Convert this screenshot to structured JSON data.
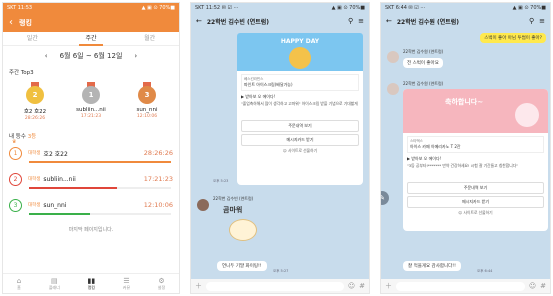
{
  "screen1": {
    "status": {
      "left": "SKT 11:53",
      "right": "▲ ▣ ⊙ 70%■"
    },
    "header": {
      "back_icon": "chevron-left-icon",
      "title": "랭킹"
    },
    "tabs": [
      "일간",
      "주간",
      "월간"
    ],
    "active_tab": 1,
    "range": {
      "prev": "‹",
      "label": "6월  6일 ~ 6월  12일",
      "next": "›"
    },
    "top3_title": "주간 Top3",
    "top3": [
      {
        "rank": "2",
        "name": "호2 호22",
        "time": "28:26:26",
        "color": "#f0c040",
        "ribbon": "#e36a4a"
      },
      {
        "rank": "1",
        "name": "subliin...nii",
        "time": "17:21:23",
        "color": "#b4b4b4",
        "ribbon": "#e36a4a"
      },
      {
        "rank": "3",
        "name": "sun_nni",
        "time": "12:10:06",
        "color": "#e08a48",
        "ribbon": "#e36a4a"
      }
    ],
    "my_rank": {
      "label": "내 등수",
      "value": "3등"
    },
    "rows": [
      {
        "num": "1",
        "badge": "대학생",
        "name": "호2 호22",
        "time": "28:26:26",
        "color": "#f08a3c",
        "fill": 1.0,
        "crown": "♛"
      },
      {
        "num": "2",
        "badge": "대학생",
        "name": "subliin...nii",
        "time": "17:21:23",
        "color": "#e0463a",
        "fill": 0.62,
        "crown": ""
      },
      {
        "num": "3",
        "badge": "대학생",
        "name": "sun_nni",
        "time": "12:10:06",
        "color": "#3ab04a",
        "fill": 0.43,
        "crown": ""
      }
    ],
    "end_text": "마지막 페이지입니다.",
    "nav": [
      {
        "icon": "⌂",
        "label": "홈",
        "name": "home-icon"
      },
      {
        "icon": "▤",
        "label": "플래너",
        "name": "planner-icon"
      },
      {
        "icon": "▮▮",
        "label": "랭킹",
        "name": "ranking-icon"
      },
      {
        "icon": "☰",
        "label": "커뮤",
        "name": "community-icon"
      },
      {
        "icon": "⚙",
        "label": "설정",
        "name": "settings-icon"
      }
    ]
  },
  "screen2": {
    "status": {
      "left": "SKT 11:52 ✉ ☑ ···",
      "right": "▲ ▣ ⊙ 70%■"
    },
    "title": "22학번 김수빈 (연트럼)",
    "card": {
      "banner": "HAPPY DAY",
      "shop": "베스킨라빈스",
      "product": "파인트 아이스크림(배달가능)",
      "from": "▶ 받아보 오 에이다!",
      "msg": "\"졸업축하해서 많이 생각하고 고마워\" 아이스크림 받을 기념으로 기대할게",
      "btn1": "주문내역 보기",
      "btn2": "메시지카드 받기",
      "btn3": "☺ 사이트로 선물하기"
    },
    "time1": "오후 5:23",
    "sender": "22학번 김수빈 (연트럼)",
    "sticker_text": "곰마워",
    "reply": "언니두 기말 화이팅!!",
    "time2": "오후 5:27"
  },
  "screen3": {
    "status": {
      "left": "SKT 6:44 ✉ ☑ ···",
      "right": "▲ ▣ ⊙ 70%■"
    },
    "title": "22학번 김수원 (연트럼)",
    "top_bubble": "스벅이 좋아 아님 투썸이 좋아?",
    "sender": "22학번 김수원 (연트럼)",
    "msg1": "전 스벅이 좋아요",
    "sticker_text": "축하합니다~",
    "card": {
      "shop": "스타벅스",
      "product": "아이스 카페 아메리카노 T 2잔",
      "from": "▶ 받아보 오 에이다!",
      "msg": "\"3등 공부타!*******  만약 건강하세요! 시험 잘 기간들고 칭찬합니다\"",
      "btn1": "주문내역 보기",
      "btn2": "메시지카드 받기",
      "btn3": "☺ 사이트로 선물하기"
    },
    "reply": "잘 먹을게요 감사합니다!!",
    "time": "오후 6:44"
  }
}
